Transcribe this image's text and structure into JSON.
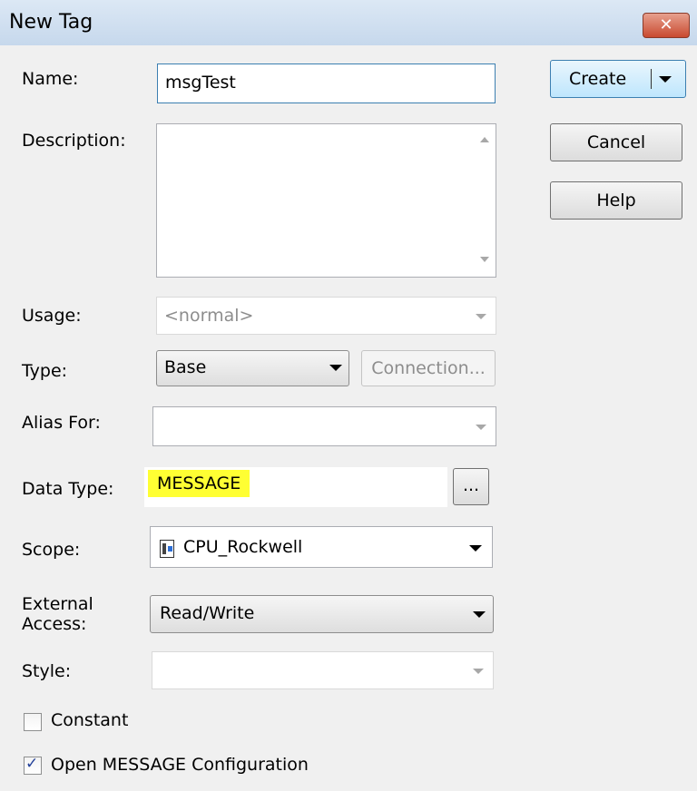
{
  "window": {
    "title": "New Tag",
    "close_glyph": "✕"
  },
  "fields": {
    "name": {
      "label": "Name:",
      "value": "msgTest"
    },
    "description": {
      "label": "Description:",
      "value": ""
    },
    "usage": {
      "label": "Usage:",
      "value": "<normal>"
    },
    "type": {
      "label": "Type:",
      "value": "Base",
      "connection_label": "Connection..."
    },
    "alias_for": {
      "label": "Alias For:",
      "value": ""
    },
    "data_type": {
      "label": "Data Type:",
      "value": "MESSAGE",
      "browse_label": "...",
      "highlight_color": "#ffff33"
    },
    "scope": {
      "label": "Scope:",
      "value": "CPU_Rockwell",
      "icon": "controller-icon"
    },
    "external_access": {
      "label_line1": "External",
      "label_line2": "Access:",
      "value": "Read/Write"
    },
    "style": {
      "label": "Style:",
      "value": ""
    }
  },
  "checkboxes": {
    "constant": {
      "label": "Constant",
      "checked": false
    },
    "open_config": {
      "label": "Open MESSAGE Configuration",
      "checked": true,
      "mark": "✓"
    }
  },
  "buttons": {
    "create": "Create",
    "cancel": "Cancel",
    "help": "Help"
  }
}
